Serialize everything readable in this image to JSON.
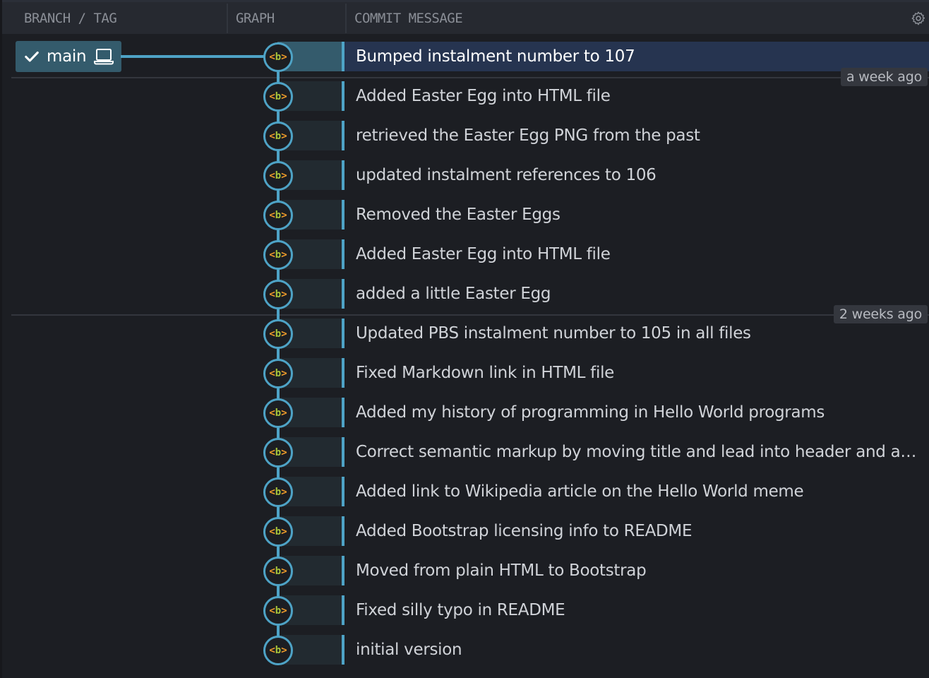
{
  "header": {
    "columns": {
      "branch_tag": "BRANCH / TAG",
      "graph": "GRAPH",
      "commit_message": "COMMIT MESSAGE"
    },
    "settings_icon": "gear-icon"
  },
  "branch": {
    "name": "main",
    "checked_out": true,
    "icons": [
      "check-icon",
      "laptop-icon"
    ]
  },
  "avatar_label": {
    "open": "<",
    "letter": "b",
    "close": ">"
  },
  "colors": {
    "accent": "#4ea3c6",
    "branch_bg": "#345b6c",
    "selected_row_bg": "#263450",
    "avatar_brackets": "#f09b2a",
    "avatar_letter": "#a6c43b",
    "background": "#1c1e23"
  },
  "date_groups": [
    {
      "label": "a week ago"
    },
    {
      "label": "2 weeks ago"
    }
  ],
  "commits": [
    {
      "message": "Bumped instalment number to 107",
      "selected": true
    },
    {
      "message": "Added Easter Egg into HTML file"
    },
    {
      "message": "retrieved the Easter Egg PNG from the past"
    },
    {
      "message": "updated instalment references to 106"
    },
    {
      "message": "Removed the Easter Eggs"
    },
    {
      "message": "Added Easter Egg into HTML file"
    },
    {
      "message": "added a little Easter Egg"
    },
    {
      "message": "Updated PBS instalment number to 105 in all files"
    },
    {
      "message": "Fixed Markdown link in HTML file"
    },
    {
      "message": "Added my history of programming in Hello World programs"
    },
    {
      "message": "Correct semantic markup by moving title and lead into header and adding footer"
    },
    {
      "message": "Added link to Wikipedia article on the Hello World meme"
    },
    {
      "message": "Added Bootstrap licensing info to README"
    },
    {
      "message": "Moved from plain HTML to Bootstrap"
    },
    {
      "message": "Fixed silly typo in README"
    },
    {
      "message": "initial version"
    }
  ]
}
